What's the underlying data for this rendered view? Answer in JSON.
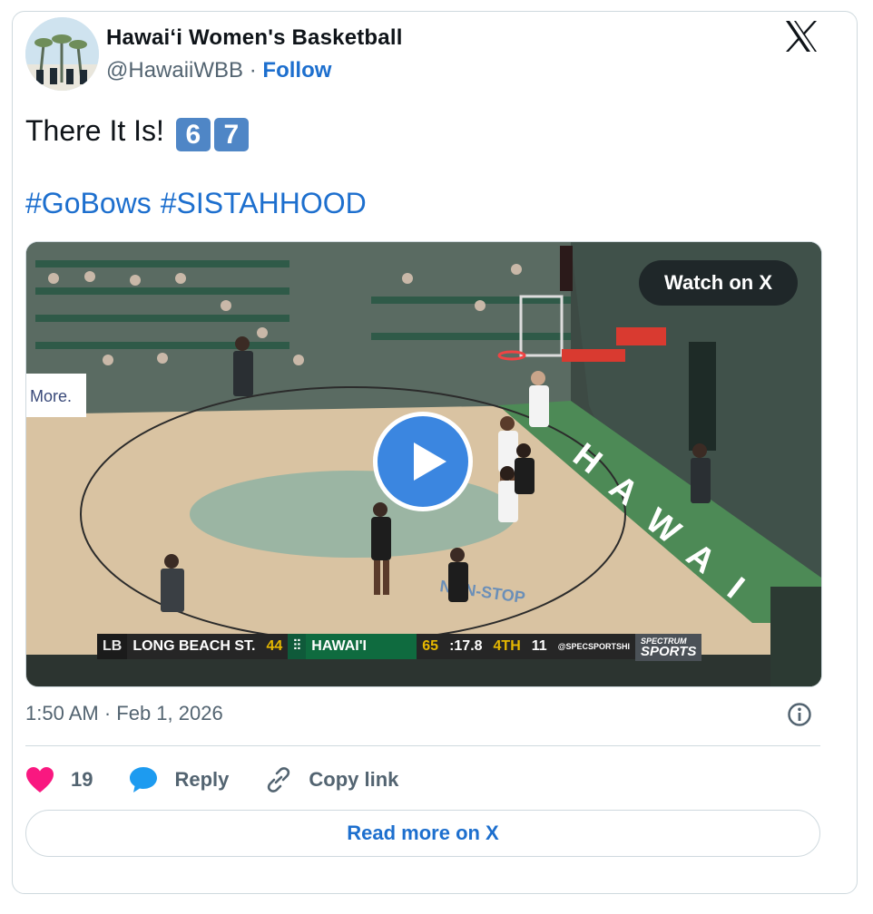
{
  "author": {
    "display_name": "Hawaiʻi Women's Basketball",
    "handle": "@HawaiiWBB",
    "separator": "·",
    "follow_label": "Follow"
  },
  "icons": {
    "brand": "x-logo-icon",
    "like": "heart-icon",
    "reply": "speech-bubble-icon",
    "copy": "link-icon",
    "info": "info-icon",
    "play": "play-icon"
  },
  "tweet": {
    "text": "There It Is!",
    "keycaps": [
      "6",
      "7"
    ],
    "hashtags": [
      "#GoBows",
      "#SISTAHHOOD"
    ]
  },
  "media": {
    "watch_label": "Watch on X",
    "court_sign": "More.",
    "scorebug": {
      "away_team": "LONG BEACH ST.",
      "away_score": "44",
      "home_team": "HAWAI'I",
      "home_score": "65",
      "clock": ":17.8",
      "quarter": "4TH",
      "shot_clock": "11",
      "credit": "@SPECSPORTSHI",
      "network_top": "SPECTRUM",
      "network_bottom": "SPORTS"
    }
  },
  "meta": {
    "timestamp": "1:50 AM · Feb 1, 2026"
  },
  "actions": {
    "likes_count": "19",
    "reply_label": "Reply",
    "copy_label": "Copy link",
    "read_more_label": "Read more on X"
  },
  "colors": {
    "link": "#1d6fce",
    "like": "#f91880",
    "reply": "#1d9bf0",
    "keycap": "#4f86c6",
    "border": "#cfd9de",
    "muted": "#536471"
  }
}
